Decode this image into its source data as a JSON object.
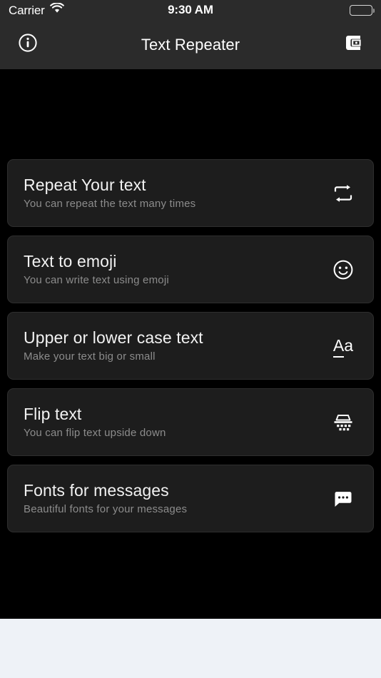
{
  "status_bar": {
    "carrier": "Carrier",
    "wifi_icon": "wifi-icon",
    "time": "9:30 AM",
    "battery_icon": "battery-icon",
    "background_color": "#2b2b2b"
  },
  "nav_bar": {
    "title": "Text Repeater",
    "left_icon": "info-circle-icon",
    "right_icon": "wallet-icon",
    "background_color": "#2b2b2b"
  },
  "theme": {
    "page_background": "#000000",
    "card_background": "#1d1d1d",
    "card_border": "#2e2e2e",
    "title_color": "#f2f2f2",
    "subtitle_color": "#8c8c8c",
    "bottom_area_color": "#eef2f7"
  },
  "main": {
    "cards": [
      {
        "title": "Repeat Your text",
        "subtitle": "You can repeat the text many times",
        "icon": "repeat-icon"
      },
      {
        "title": "Text to emoji",
        "subtitle": "You can write text using emoji",
        "icon": "smiley-face-icon"
      },
      {
        "title": "Upper or lower case text",
        "subtitle": "Make your text big or small",
        "icon": "text-case-aa-icon",
        "icon_text_cap": "A",
        "icon_text_low": "a"
      },
      {
        "title": "Flip text",
        "subtitle": "You can flip text upside down",
        "icon": "flip-vertical-icon"
      },
      {
        "title": "Fonts for messages",
        "subtitle": "Beautiful fonts for your messages",
        "icon": "chat-bubble-dots-icon"
      }
    ]
  }
}
